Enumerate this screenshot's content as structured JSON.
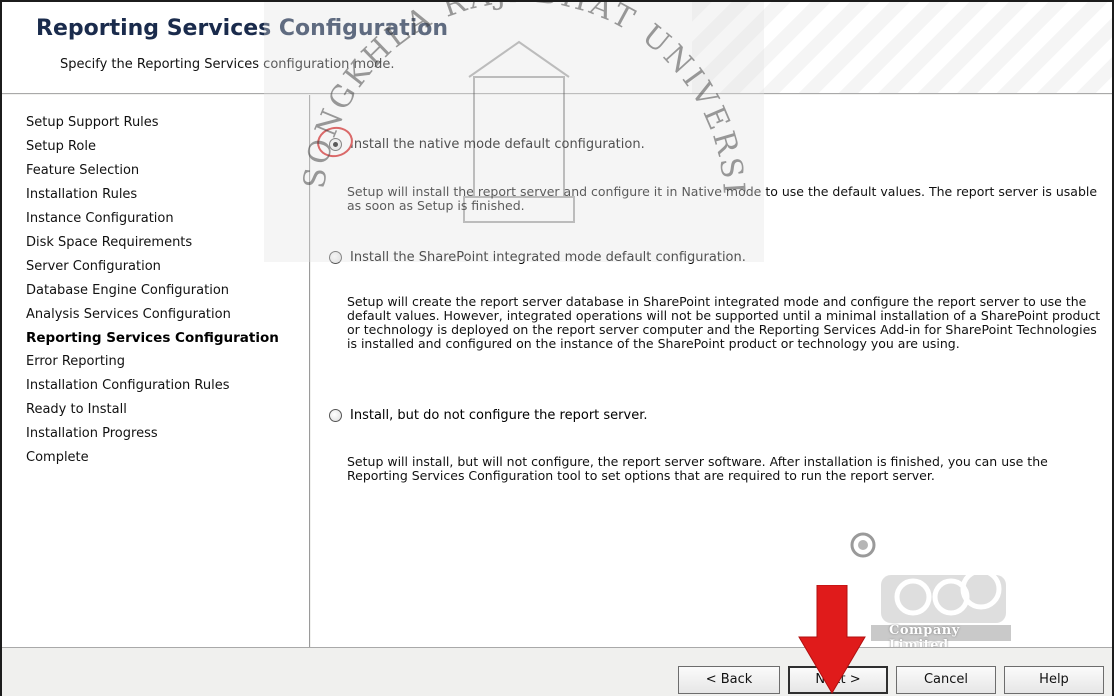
{
  "header": {
    "title": "Reporting Services Configuration",
    "subtitle": "Specify the Reporting Services configuration mode."
  },
  "sidebar": {
    "steps": [
      {
        "label": "Setup Support Rules"
      },
      {
        "label": "Setup Role"
      },
      {
        "label": "Feature Selection"
      },
      {
        "label": "Installation Rules"
      },
      {
        "label": "Instance Configuration"
      },
      {
        "label": "Disk Space Requirements"
      },
      {
        "label": "Server Configuration"
      },
      {
        "label": "Database Engine Configuration"
      },
      {
        "label": "Analysis Services Configuration"
      },
      {
        "label": "Reporting Services Configuration",
        "current": true
      },
      {
        "label": "Error Reporting"
      },
      {
        "label": "Installation Configuration Rules"
      },
      {
        "label": "Ready to Install"
      },
      {
        "label": "Installation Progress"
      },
      {
        "label": "Complete"
      }
    ]
  },
  "options": [
    {
      "label": "Install the native mode default configuration.",
      "selected": true,
      "description": "Setup will install the report server and configure it in Native mode to use the default values. The report server is usable as soon as Setup is finished."
    },
    {
      "label": "Install the SharePoint integrated mode default configuration.",
      "selected": false,
      "description": "Setup will create the report server database in SharePoint integrated mode and configure the report server to use the default values. However, integrated operations will not be supported until a minimal installation of a SharePoint product or technology is deployed on the report server computer and the Reporting Services Add-in for SharePoint Technologies is installed and configured on the instance of the SharePoint product or technology you are using."
    },
    {
      "label": "Install, but do not configure the report server.",
      "selected": false,
      "description": "Setup will install, but will not configure, the report server software. After installation is finished, you can use the Reporting Services Configuration tool to set options that are required to run the report server."
    }
  ],
  "watermark": {
    "text": "SONGKHLA RAJABHAT UNIVERSITY"
  },
  "logo": {
    "text": "Company Limited"
  },
  "buttons": {
    "back": "< Back",
    "next": "Next >",
    "cancel": "Cancel",
    "help": "Help"
  },
  "colors": {
    "title": "#1a2b4c",
    "annotation": "#e01b1b"
  },
  "icons": {
    "arrow": "red-down-arrow-icon",
    "highlight": "red-circle-highlight",
    "logo": "company-logo-icon"
  }
}
